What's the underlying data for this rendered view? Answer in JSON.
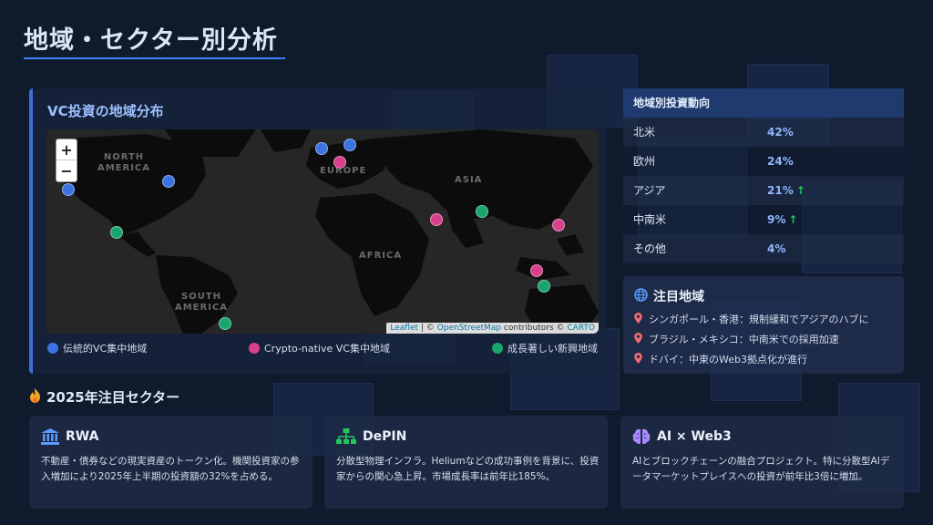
{
  "page": {
    "title": "地域・セクター別分析"
  },
  "map_panel": {
    "title": "VC投資の地域分布",
    "zoom_in": "+",
    "zoom_out": "−",
    "continents": [
      "NORTH AMERICA",
      "EUROPE",
      "ASIA",
      "AFRICA",
      "SOUTH AMERICA"
    ],
    "attribution": {
      "leaflet": "Leaflet",
      "sep1": " | © ",
      "osm": "OpenStreetMap",
      "mid": " contributors © ",
      "carto": "CARTO"
    },
    "legend": [
      {
        "label": "伝統的VC集中地域",
        "color": "#3b74e0"
      },
      {
        "label": "Crypto-native VC集中地域",
        "color": "#d8418a"
      },
      {
        "label": "成長著しい新興地域",
        "color": "#19a56e"
      }
    ]
  },
  "investment_table": {
    "header": "地域別投資動向",
    "rows": [
      {
        "region": "北米",
        "share": "42%",
        "trend": ""
      },
      {
        "region": "欧州",
        "share": "24%",
        "trend": ""
      },
      {
        "region": "アジア",
        "share": "21%",
        "trend": "↑"
      },
      {
        "region": "中南米",
        "share": "9%",
        "trend": "↑"
      },
      {
        "region": "その他",
        "share": "4%",
        "trend": ""
      }
    ]
  },
  "focus_regions": {
    "title": "注目地域",
    "items": [
      "シンガポール・香港：規制緩和でアジアのハブに",
      "ブラジル・メキシコ：中南米での採用加速",
      "ドバイ：中東のWeb3拠点化が進行"
    ]
  },
  "sectors": {
    "heading": "2025年注目セクター",
    "cards": [
      {
        "title": "RWA",
        "icon": "bank-icon",
        "body": "不動産・債券などの現実資産のトークン化。機関投資家の参入増加により2025年上半期の投資額の32%を占める。"
      },
      {
        "title": "DePIN",
        "icon": "network-icon",
        "body": "分散型物理インフラ。Heliumなどの成功事例を背景に、投資家からの関心急上昇。市場成長率は前年比185%。"
      },
      {
        "title": "AI × Web3",
        "icon": "brain-icon",
        "body": "AIとブロックチェーンの融合プロジェクト。特に分散型AIデータマーケットプレイスへの投資が前年比3倍に増加。"
      }
    ]
  },
  "colors": {
    "accent": "#3b82f6",
    "blue": "#3b74e0",
    "pink": "#d8418a",
    "green": "#19a56e",
    "up": "#22c55e"
  }
}
